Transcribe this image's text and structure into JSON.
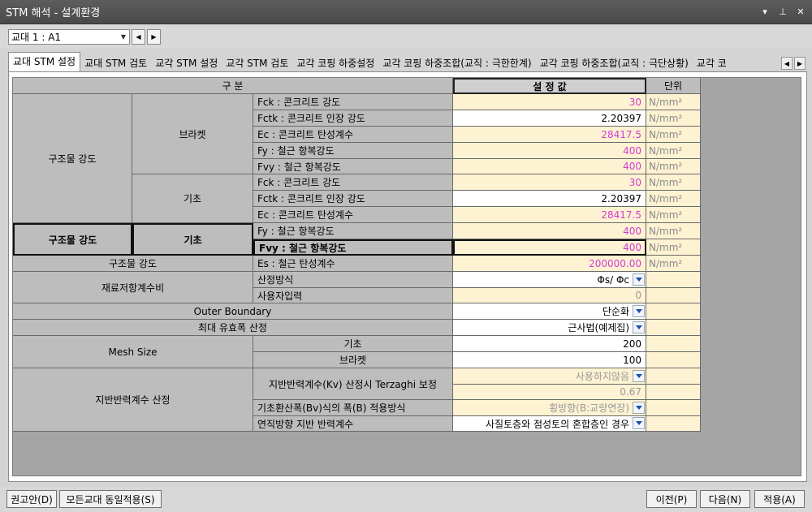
{
  "window": {
    "title": "STM 해석 - 설계환경"
  },
  "toolbar": {
    "selector_value": "교대 1 : A1"
  },
  "tabs": [
    "교대 STM 설정",
    "교대 STM 검토",
    "교각 STM 설정",
    "교각 STM 검토",
    "교각 코핑 하중설정",
    "교각 코핑 하중조합(교직 : 극한한계)",
    "교각 코핑 하중조합(교직 : 극단상황)",
    "교각 코"
  ],
  "header": {
    "category": "구    분",
    "value": "설 정 값",
    "unit": "단위"
  },
  "groups": {
    "structural_strength": "구조물 강도",
    "bracket": "브라켓",
    "foundation": "기초",
    "material_factor": "재료저항계수비",
    "outer_boundary": "Outer Boundary",
    "max_effective_width": "최대 유효폭 산정",
    "mesh_size": "Mesh Size",
    "subgrade": "지반반력계수 산정"
  },
  "rows": {
    "b_fck": {
      "label": "Fck : 콘크리트 강도",
      "value": "30",
      "unit": "N/mm²"
    },
    "b_fctk": {
      "label": "Fctk : 콘크리트 인장 강도",
      "value": "2.20397",
      "unit": "N/mm²"
    },
    "b_ec": {
      "label": "Ec : 콘크리트 탄성계수",
      "value": "28417.5",
      "unit": "N/mm²"
    },
    "b_fy": {
      "label": "Fy : 철근 항복강도",
      "value": "400",
      "unit": "N/mm²"
    },
    "b_fvy": {
      "label": "Fvy : 철근 항복강도",
      "value": "400",
      "unit": "N/mm²"
    },
    "f_fck": {
      "label": "Fck : 콘크리트 강도",
      "value": "30",
      "unit": "N/mm²"
    },
    "f_fctk": {
      "label": "Fctk : 콘크리트 인장 강도",
      "value": "2.20397",
      "unit": "N/mm²"
    },
    "f_ec": {
      "label": "Ec : 콘크리트 탄성계수",
      "value": "28417.5",
      "unit": "N/mm²"
    },
    "f_fy": {
      "label": "Fy : 철근 항복강도",
      "value": "400",
      "unit": "N/mm²"
    },
    "f_fvy": {
      "label": "Fvy : 철근 항복강도",
      "value": "400",
      "unit": "N/mm²"
    },
    "es": {
      "label": "Es : 철근 탄성계수",
      "value": "200000.00",
      "unit": "N/mm²"
    },
    "calc_method": {
      "label": "산정방식",
      "value": "Φs/ Φc"
    },
    "user_input": {
      "label": "사용자입력",
      "value": "0"
    },
    "outer_boundary": {
      "value": "단순화"
    },
    "max_effective_width": {
      "value": "근사법(예제집)"
    },
    "mesh_foundation": {
      "label": "기초",
      "value": "200"
    },
    "mesh_bracket": {
      "label": "브라켓",
      "value": "100"
    },
    "kv_terzaghi": {
      "label": "지반반력계수(Kv) 산정시 Terzaghi 보정",
      "value": "사용하지않음"
    },
    "kv_value": {
      "value": "0.67"
    },
    "bv_method": {
      "label": "기초환산폭(Bv)식의 폭(B) 적용방식",
      "value": "횡방향(B:교량연장)"
    },
    "vertical_reaction": {
      "label": "연직방향 지반 반력계수",
      "value": "사질토층와 점성토의 혼합층인 경우"
    }
  },
  "buttons": {
    "recommend": "권고안(D)",
    "apply_all": "모든교대 동일적용(S)",
    "prev": "이전(P)",
    "next": "다음(N)",
    "apply": "적용(A)"
  }
}
